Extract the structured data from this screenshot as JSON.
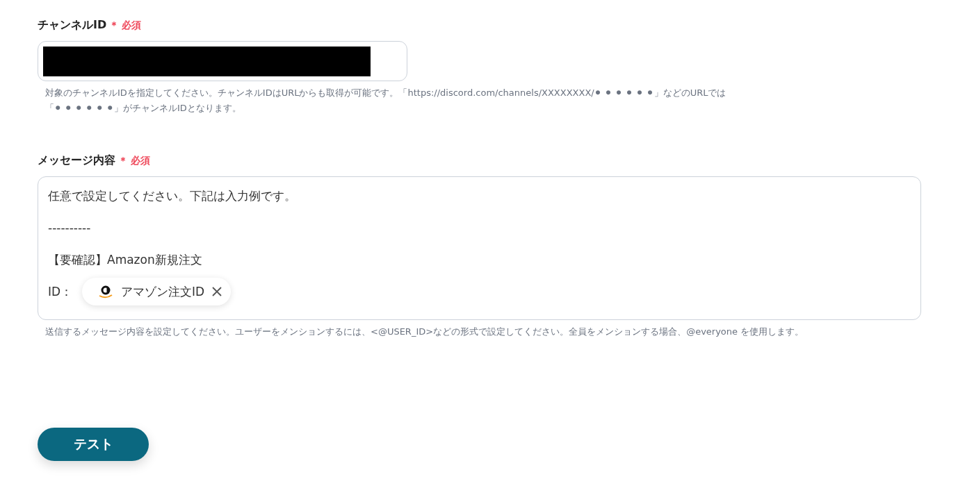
{
  "fields": [
    {
      "kind": "input",
      "label": "チャンネルID",
      "required_mark": "＊",
      "required_text": "必須",
      "redacted": true,
      "help_lines": [
        "対象のチャンネルIDを指定してください。チャンネルIDはURLからも取得が可能です。「https://discord.com/channels/XXXXXXXX/⚫ ⚫ ⚫ ⚫ ⚫ ⚫」などのURLでは",
        "「⚫ ⚫ ⚫ ⚫ ⚫ ⚫」がチャンネルIDとなります。"
      ]
    },
    {
      "kind": "textarea",
      "label": "メッセージ内容",
      "required_mark": "＊",
      "required_text": "必須",
      "lines": [
        {
          "text": "任意で設定してください。下記は入力例です。"
        },
        {
          "text": "----------"
        },
        {
          "text": "【要確認】Amazon新規注文"
        },
        {
          "text": "ID：",
          "chip": {
            "label": "アマゾン注文ID"
          }
        }
      ],
      "help_lines": [
        "送信するメッセージ内容を設定してください。ユーザーをメンションするには、<@USER_ID>などの形式で設定してください。全員をメンションする場合、@everyone を使用します。"
      ]
    }
  ],
  "button": {
    "label": "テスト"
  }
}
